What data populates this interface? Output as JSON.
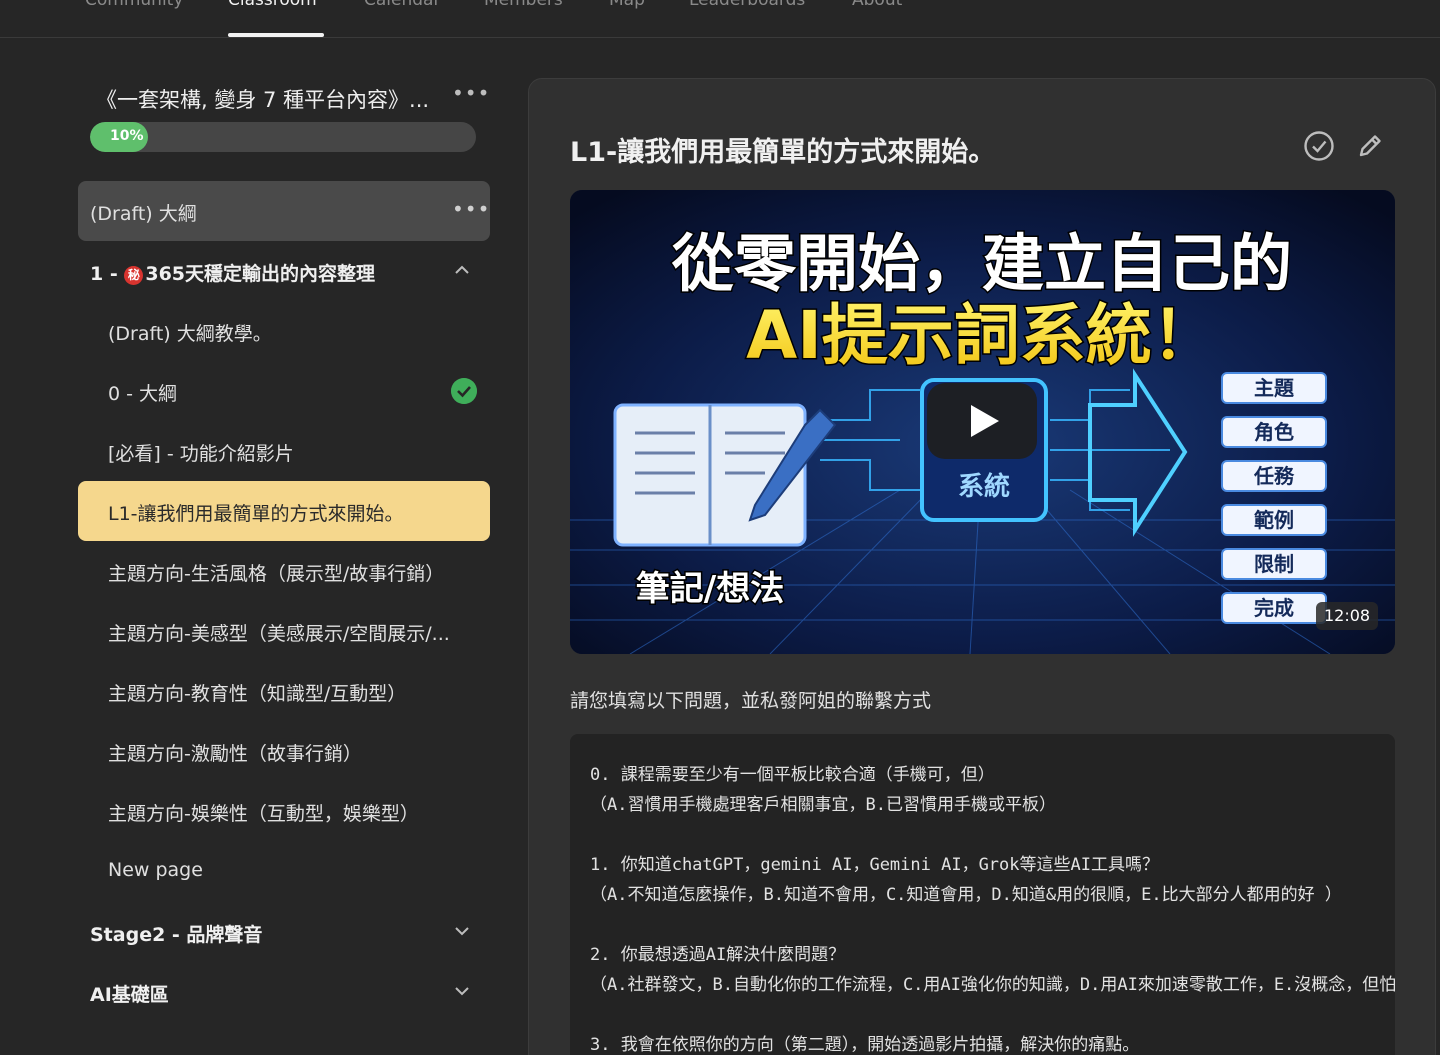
{
  "nav": {
    "tabs": [
      "Community",
      "Classroom",
      "Calendar",
      "Members",
      "Map",
      "Leaderboards",
      "About"
    ],
    "active": "Classroom"
  },
  "sidebar": {
    "course_title": "《一套架構, 變身 7 種平台內容》...",
    "more_icon": "ellipsis-icon",
    "progress_label": "10%",
    "progress_value": 0.1,
    "items": [
      {
        "label": "(Draft) 大綱"
      },
      {
        "label": "1 - ",
        "label_rest": "365天穩定輸出的內容整理",
        "badge": "秘"
      },
      {
        "label": "(Draft) 大綱教學。"
      },
      {
        "label": "0 - 大綱",
        "completed": true
      },
      {
        "label": "[必看] - 功能介紹影片"
      },
      {
        "label": "L1-讓我們用最簡單的方式來開始。"
      },
      {
        "label": "主題方向-生活風格（展示型/故事行銷）"
      },
      {
        "label": "主題方向-美感型（美感展示/空間展示/..."
      },
      {
        "label": "主題方向-教育性（知識型/互動型）"
      },
      {
        "label": "主題方向-激勵性（故事行銷）"
      },
      {
        "label": "主題方向-娛樂性（互動型，娛樂型）"
      },
      {
        "label": "New page"
      },
      {
        "label": "Stage2 - 品牌聲音"
      },
      {
        "label": "AI基礎區"
      }
    ]
  },
  "main": {
    "title": "L1-讓我們用最簡單的方式來開始。",
    "video": {
      "headline1": "從零開始，建立自己的",
      "headline2": "AI提示詞系統！",
      "left_caption": "筆記/想法",
      "chip_text": "系統",
      "steps": [
        "主題",
        "角色",
        "任務",
        "範例",
        "限制",
        "完成"
      ],
      "duration": "12:08"
    },
    "intro": "請您填寫以下問題，並私發阿姐的聯繫方式",
    "questions": [
      "0. 課程需要至少有一個平板比較合適（手機可，但）",
      "（A.習慣用手機處理客戶相關事宜，B.已習慣用手機或平板）",
      "",
      "1. 你知道chatGPT，gemini AI，Gemini AI，Grok等這些AI工具嗎？",
      "（A.不知道怎麼操作，B.知道不會用，C.知道會用，D.知道&用的很順，E.比大部分人都用的好 ）",
      "",
      "2. 你最想透過AI解決什麼問題？",
      "（A.社群發文，B.自動化你的工作流程，C.用AI強化你的知識，D.用AI來加速零散工作，E.沒概念，但怕",
      "",
      "3. 我會在依照你的方向（第二題），開始透過影片拍攝，解決你的痛點。"
    ]
  },
  "colors": {
    "background": "#262626",
    "panel": "#303030",
    "selected_item": "#f5d78d",
    "progress": "#5fbf6c",
    "check": "#3fae5a"
  }
}
